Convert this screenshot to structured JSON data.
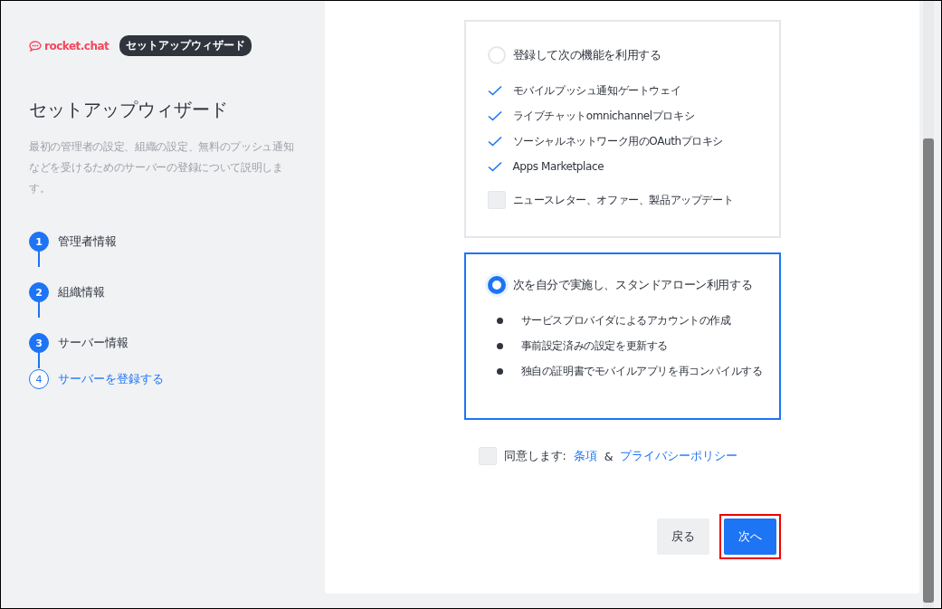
{
  "sidebar": {
    "logo_text": "rocket.chat",
    "badge": "セットアップウィザード",
    "title": "セットアップウィザード",
    "description": "最初の管理者の設定、組織の設定、無料のプッシュ通知などを受けるためのサーバーの登録について説明します。",
    "steps": [
      {
        "number": "1",
        "label": "管理者情報",
        "completed": true,
        "selected": false
      },
      {
        "number": "2",
        "label": "組織情報",
        "completed": true,
        "selected": false
      },
      {
        "number": "3",
        "label": "サーバー情報",
        "completed": true,
        "selected": false
      },
      {
        "number": "4",
        "label": "サーバーを登録する",
        "completed": false,
        "selected": true
      }
    ]
  },
  "options": [
    {
      "label": "登録して次の機能を利用する",
      "selected": false,
      "kind": "checks",
      "features": [
        "モバイルプッシュ通知ゲートウェイ",
        "ライブチャットomnichannelプロキシ",
        "ソーシャルネットワーク用のOAuthプロキシ",
        "Apps Marketplace"
      ],
      "newsletter": {
        "label": "ニュースレター、オファー、製品アップデート",
        "checked": false
      }
    },
    {
      "label": "次を自分で実施し、スタンドアローン利用する",
      "selected": true,
      "kind": "bullets",
      "features": [
        "サービスプロバイダによるアカウントの作成",
        "事前設定済みの設定を更新する",
        "独自の証明書でモバイルアプリを再コンパイルする"
      ]
    }
  ],
  "agreement": {
    "checked": false,
    "prefix": "同意します:",
    "terms_link": "条項",
    "joiner": "&",
    "privacy_link": "プライバシーポリシー"
  },
  "buttons": [
    {
      "label": "戻る",
      "kind": "secondary",
      "highlighted": false
    },
    {
      "label": "次へ",
      "kind": "primary",
      "highlighted": true
    }
  ]
}
